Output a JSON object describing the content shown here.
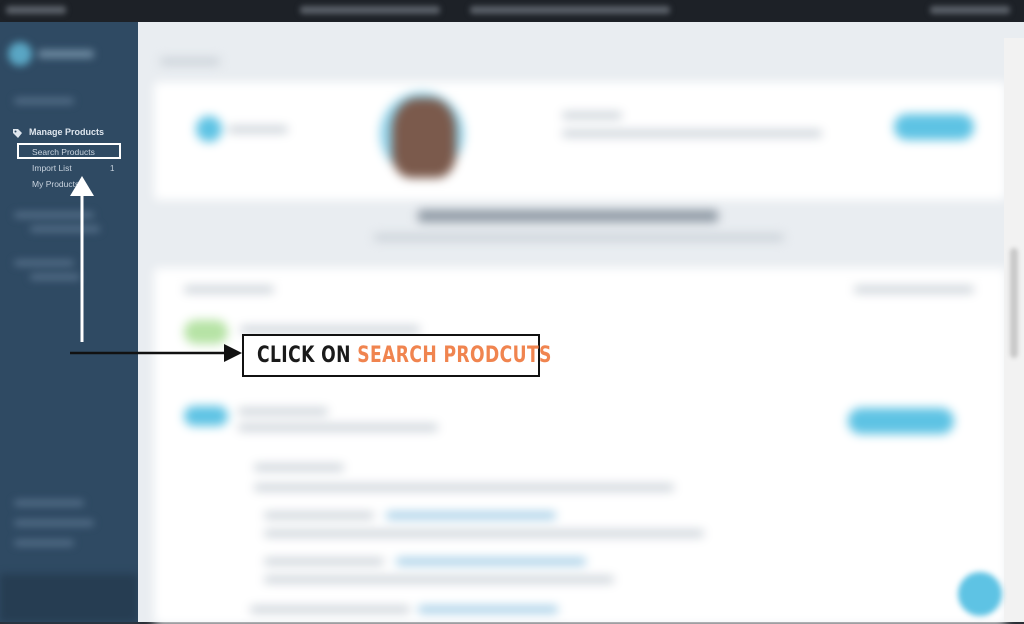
{
  "sidebar": {
    "section_label": "Manage Products",
    "section_icon": "tag-icon",
    "items": [
      {
        "label": "Search Products"
      },
      {
        "label": "Import List",
        "badge": "1"
      },
      {
        "label": "My Products"
      }
    ]
  },
  "callout": {
    "text_part1": "CLICK ON ",
    "text_part2": "SEARCH PRODCUTS"
  },
  "colors": {
    "sidebar_bg": "#2f4a63",
    "main_bg": "#e9edf1",
    "accent": "#5ec3e4",
    "callout_highlight": "#f0844f",
    "callout_text": "#1a1a1a"
  }
}
